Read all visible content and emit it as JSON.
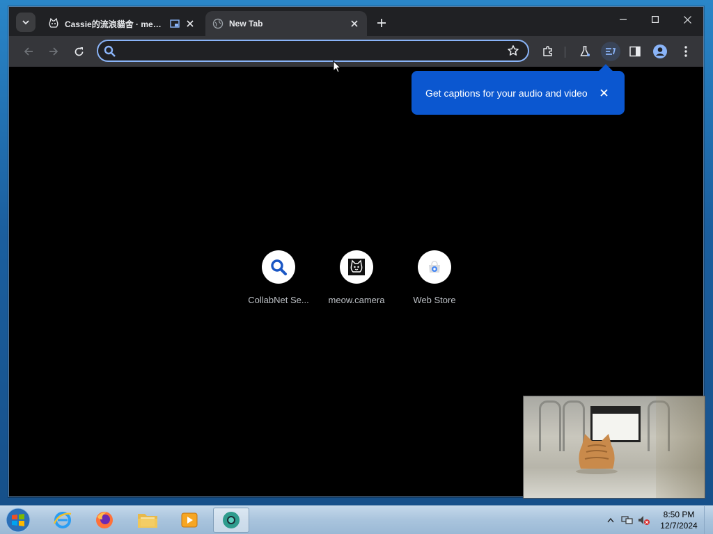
{
  "tabs": [
    {
      "title": "Cassie的流浪貓舍 · meow.c",
      "active": false
    },
    {
      "title": "New Tab",
      "active": true
    }
  ],
  "omnibox": {
    "value": "",
    "placeholder": ""
  },
  "bubble": {
    "message": "Get captions for your audio and video"
  },
  "shortcuts": [
    {
      "label": "CollabNet Se...",
      "icon": "search-icon"
    },
    {
      "label": "meow.camera",
      "icon": "cat-icon"
    },
    {
      "label": "Web Store",
      "icon": "web-store-icon"
    }
  ],
  "clock": {
    "time": "8:50 PM",
    "date": "12/7/2024"
  },
  "colors": {
    "accent": "#8ab4f8",
    "bubble": "#0b57d0",
    "tab_active": "#35363a",
    "frame": "#202124"
  }
}
